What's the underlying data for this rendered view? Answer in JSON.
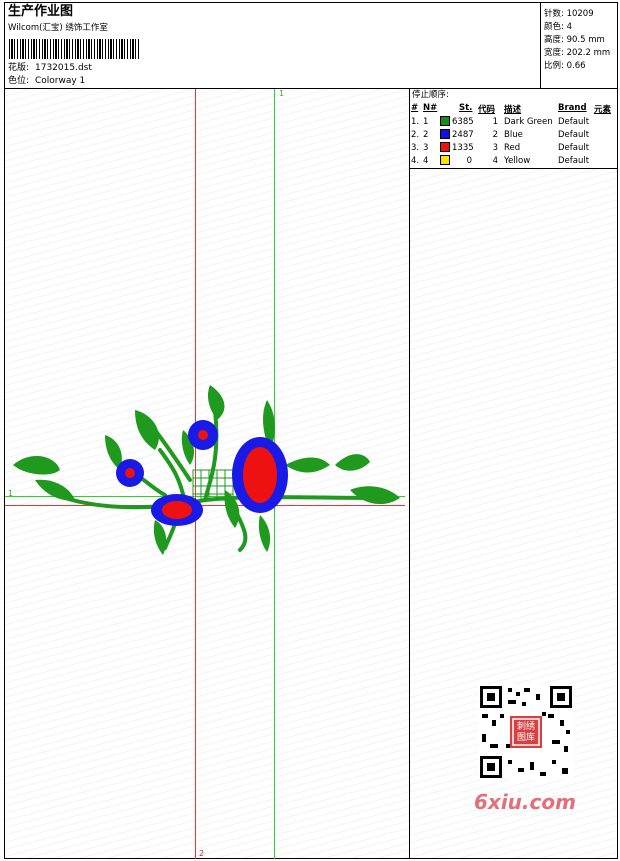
{
  "header": {
    "title": "生产作业图",
    "company": "Wilcom(汇宝) 绣饰工作室",
    "design_label": "花版:",
    "design_value": "1732015.dst",
    "colorway_label": "色位:",
    "colorway_value": "Colorway 1"
  },
  "stats": [
    {
      "label": "针数:",
      "value": "10209"
    },
    {
      "label": "颜色:",
      "value": "4"
    },
    {
      "label": "高度:",
      "value": "90.5 mm"
    },
    {
      "label": "宽度:",
      "value": "202.2 mm"
    },
    {
      "label": "比例:",
      "value": "0.66"
    }
  ],
  "stop_sequence": {
    "title": "停止顺序:",
    "headers": [
      "#",
      "N#",
      "St.",
      "代码",
      "描述",
      "Brand",
      "元素"
    ],
    "rows": [
      {
        "idx": "1.",
        "n": "1",
        "color": "#1a8a1a",
        "st": "6385",
        "code": "1",
        "desc": "Dark Green",
        "brand": "Default"
      },
      {
        "idx": "2.",
        "n": "2",
        "color": "#1010e0",
        "st": "2487",
        "code": "2",
        "desc": "Blue",
        "brand": "Default"
      },
      {
        "idx": "3.",
        "n": "3",
        "color": "#ee1111",
        "st": "1335",
        "code": "3",
        "desc": "Red",
        "brand": "Default"
      },
      {
        "idx": "4.",
        "n": "4",
        "color": "#f5e600",
        "st": "0",
        "code": "4",
        "desc": "Yellow",
        "brand": "Default"
      }
    ]
  },
  "guides": {
    "green_v": "1",
    "green_h": "1",
    "red_v": "2"
  },
  "watermark": "6xiu.com",
  "qr_stamp": "刺绣图库",
  "colors": {
    "green": "#1f9a1f",
    "blue": "#1a1ae6",
    "red": "#ee1111",
    "guide_red": "#ee3333",
    "guide_green": "#33cc33",
    "watermark": "#e0707a"
  }
}
